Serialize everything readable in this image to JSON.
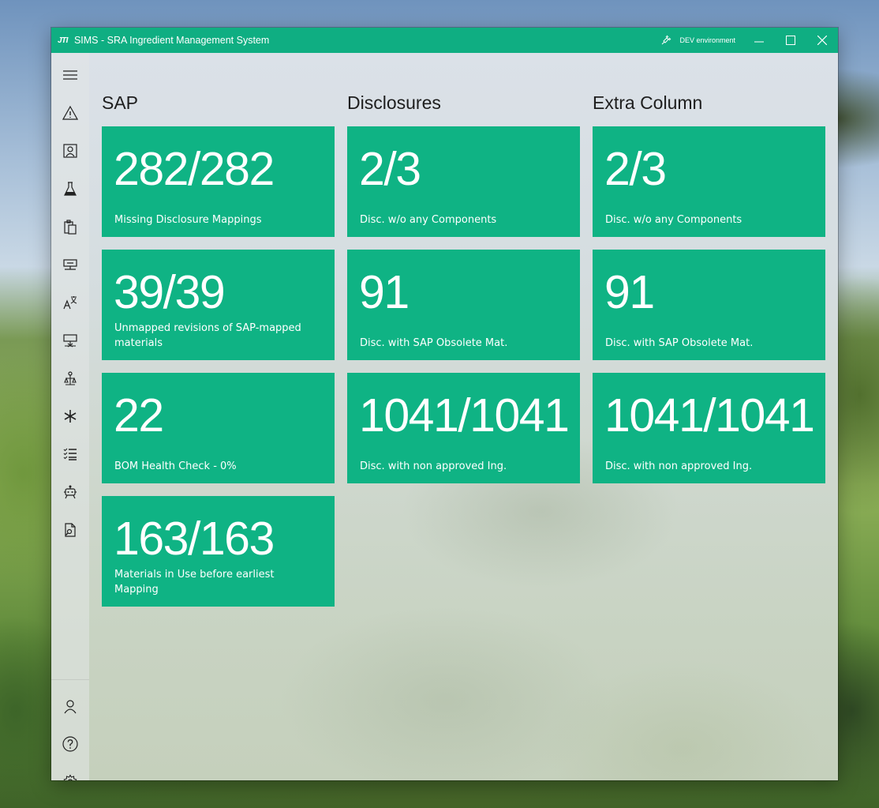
{
  "window": {
    "logo": "JTI",
    "title": "SIMS - SRA Ingredient Management System",
    "environment": "DEV environment",
    "controls": [
      "minimize",
      "maximize",
      "close"
    ]
  },
  "sidebar": {
    "top_items": [
      {
        "icon": "hamburger-menu-icon"
      },
      {
        "icon": "warning-icon"
      },
      {
        "icon": "contact-card-icon"
      },
      {
        "icon": "flask-icon"
      },
      {
        "icon": "clipboard-icon"
      },
      {
        "icon": "network-icon"
      },
      {
        "icon": "translate-icon"
      },
      {
        "icon": "network-alt-icon"
      },
      {
        "icon": "scale-icon"
      },
      {
        "icon": "asterisk-icon"
      },
      {
        "icon": "checklist-icon"
      },
      {
        "icon": "robot-icon"
      },
      {
        "icon": "document-search-icon"
      }
    ],
    "bottom_items": [
      {
        "icon": "user-icon"
      },
      {
        "icon": "help-icon"
      },
      {
        "icon": "settings-gear-icon"
      }
    ]
  },
  "columns": [
    {
      "title": "SAP",
      "tiles": [
        {
          "value": "282/282",
          "label": "Missing Disclosure Mappings"
        },
        {
          "value": "39/39",
          "label": "Unmapped revisions of SAP-mapped materials"
        },
        {
          "value": "22",
          "label": "BOM Health Check - 0%"
        },
        {
          "value": "163/163",
          "label": "Materials in Use before earliest Mapping"
        }
      ]
    },
    {
      "title": "Disclosures",
      "tiles": [
        {
          "value": "2/3",
          "label": "Disc. w/o any Components"
        },
        {
          "value": "91",
          "label": "Disc. with SAP Obsolete Mat."
        },
        {
          "value": "1041/1041",
          "label": "Disc. with non approved Ing."
        }
      ]
    },
    {
      "title": "Extra Column",
      "tiles": [
        {
          "value": "2/3",
          "label": "Disc. w/o any Components"
        },
        {
          "value": "91",
          "label": "Disc. with SAP Obsolete Mat."
        },
        {
          "value": "1041/1041",
          "label": "Disc. with non approved Ing."
        }
      ]
    }
  ],
  "colors": {
    "accent": "#0fb384",
    "titlebar": "#0fae82"
  }
}
